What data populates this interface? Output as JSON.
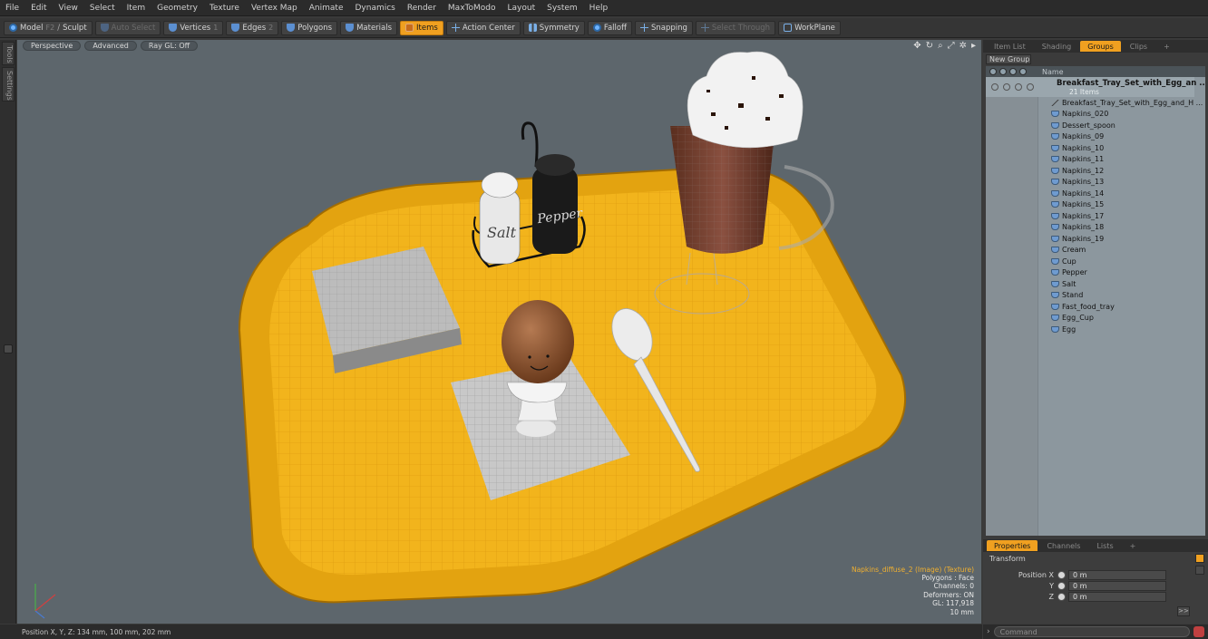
{
  "menu": [
    "File",
    "Edit",
    "View",
    "Select",
    "Item",
    "Geometry",
    "Texture",
    "Vertex Map",
    "Animate",
    "Dynamics",
    "Render",
    "MaxToModo",
    "Layout",
    "System",
    "Help"
  ],
  "toolbar": {
    "model": "Model",
    "model_key": "F2",
    "sculpt": "Sculpt",
    "auto_select": "Auto Select",
    "vertices": "Vertices",
    "vertices_key": "1",
    "edges": "Edges",
    "edges_key": "2",
    "polygons": "Polygons",
    "materials": "Materials",
    "items": "Items",
    "action_center": "Action Center",
    "symmetry": "Symmetry",
    "falloff": "Falloff",
    "snapping": "Snapping",
    "select_through": "Select Through",
    "workplane": "WorkPlane"
  },
  "left_tabs": [
    "Tools",
    "Settings"
  ],
  "viewport": {
    "perspective": "Perspective",
    "advanced": "Advanced",
    "raygl": "Ray GL: Off",
    "salt_label": "Salt",
    "pepper_label": "Pepper",
    "info": {
      "texture": "Napkins_diffuse_2 (Image) (Texture)",
      "polygons": "Polygons : Face",
      "channels": "Channels: 0",
      "deformers": "Deformers: ON",
      "gl": "GL: 117,918",
      "scale": "10 mm"
    }
  },
  "status_bar": "Position X, Y, Z:  134 mm, 100 mm, 202 mm",
  "right_panel": {
    "tabs": [
      "Item List",
      "Shading",
      "Groups",
      "Clips",
      "+"
    ],
    "active_tab": "Groups",
    "new_group": "New Group",
    "column_name": "Name",
    "group_name": "Breakfast_Tray_Set_with_Egg_an ...",
    "group_count": "21 Items",
    "items": [
      "Breakfast_Tray_Set_with_Egg_and_H ...",
      "Napkins_020",
      "Dessert_spoon",
      "Napkins_09",
      "Napkins_10",
      "Napkins_11",
      "Napkins_12",
      "Napkins_13",
      "Napkins_14",
      "Napkins_15",
      "Napkins_17",
      "Napkins_18",
      "Napkins_19",
      "Cream",
      "Cup",
      "Pepper",
      "Salt",
      "Stand",
      "Fast_food_tray",
      "Egg_Cup",
      "Egg"
    ],
    "props_tabs": [
      "Properties",
      "Channels",
      "Lists",
      "+"
    ],
    "transform": "Transform",
    "position_x_label": "Position X",
    "y_label": "Y",
    "z_label": "Z",
    "x_val": "0 m",
    "y_val": "0 m",
    "z_val": "0 m",
    "more": ">>"
  },
  "command": "Command",
  "colors": {
    "accent": "#f0a020",
    "tray": "#f2b41c",
    "viewport_bg": "#5d666c"
  }
}
